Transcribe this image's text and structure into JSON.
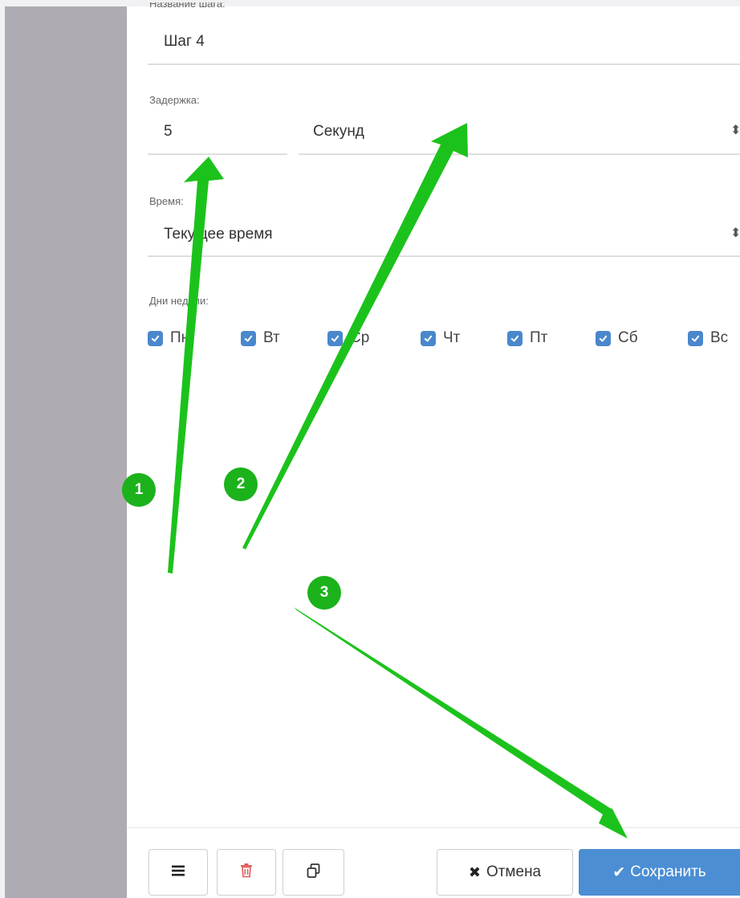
{
  "form": {
    "step_name": {
      "label": "Название шага:",
      "value": "Шаг 4"
    },
    "delay": {
      "label": "Задержка:",
      "value": "5",
      "unit": "Секунд"
    },
    "time": {
      "label": "Время:",
      "value": "Текущее время"
    },
    "days": {
      "label": "Дни недели:",
      "items": [
        {
          "label": "Пн",
          "checked": true
        },
        {
          "label": "Вт",
          "checked": true
        },
        {
          "label": "Ср",
          "checked": true
        },
        {
          "label": "Чт",
          "checked": true
        },
        {
          "label": "Пт",
          "checked": true
        },
        {
          "label": "Сб",
          "checked": true
        },
        {
          "label": "Вс",
          "checked": true
        }
      ]
    }
  },
  "footer": {
    "cancel_label": "Отмена",
    "save_label": "Сохранить"
  },
  "annotations": {
    "badges": [
      "1",
      "2",
      "3"
    ]
  },
  "icons": {
    "menu": "hamburger-icon",
    "delete": "trash-icon",
    "copy": "copy-icon",
    "cancel": "x-icon",
    "save": "checkmark-icon",
    "select": "select-arrows-icon",
    "checkbox": "checkmark-icon"
  },
  "colors": {
    "accent": "#4c8ed3",
    "checkbox": "#4a87cc",
    "annotation": "#1bb21b",
    "delete_icon": "#e05a5a",
    "sidebar": "#aeacb2"
  }
}
